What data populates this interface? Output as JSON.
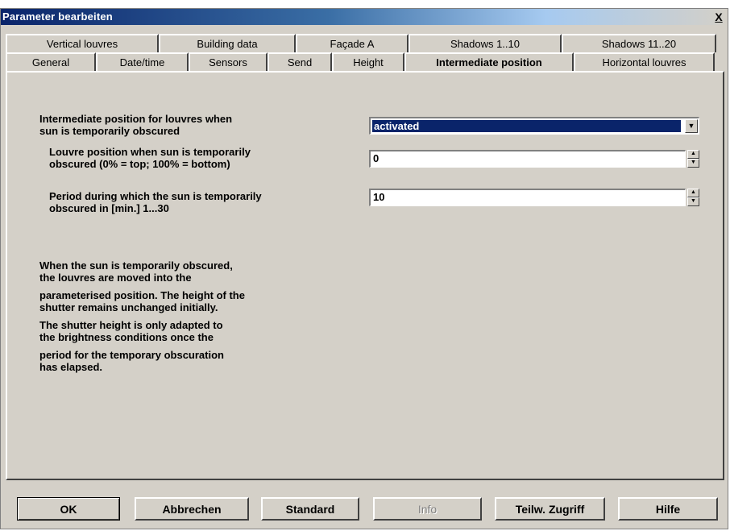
{
  "window": {
    "title": "Parameter bearbeiten",
    "close_label": "X"
  },
  "tabs": {
    "row1": [
      "Vertical louvres",
      "Building data",
      "Façade A",
      "Shadows 1..10",
      "Shadows 11..20"
    ],
    "row2": [
      "General",
      "Date/time",
      "Sensors",
      "Send",
      "Height",
      "Intermediate position",
      "Horizontal louvres"
    ],
    "active": "Intermediate position"
  },
  "params": {
    "intermediate": {
      "label1": "Intermediate position for louvres when",
      "label2": "sun is temporarily obscured",
      "value": "activated"
    },
    "louvre_pos": {
      "label1": "Louvre position when sun is temporarily",
      "label2": "obscured (0% = top; 100% = bottom)",
      "value": "0"
    },
    "period": {
      "label1": "Period during which the sun is temporarily",
      "label2": "obscured in [min.] 1...30",
      "value": "10"
    }
  },
  "description": [
    "When the sun is temporarily obscured,",
    "the louvres are moved into the",
    "parameterised position. The height of the",
    "shutter remains unchanged initially.",
    "The shutter height is only adapted to",
    "the brightness conditions once the",
    "period for the temporary obscuration",
    "has elapsed."
  ],
  "buttons": {
    "ok": "OK",
    "cancel": "Abbrechen",
    "standard": "Standard",
    "info": "Info",
    "partial": "Teilw. Zugriff",
    "help": "Hilfe"
  }
}
